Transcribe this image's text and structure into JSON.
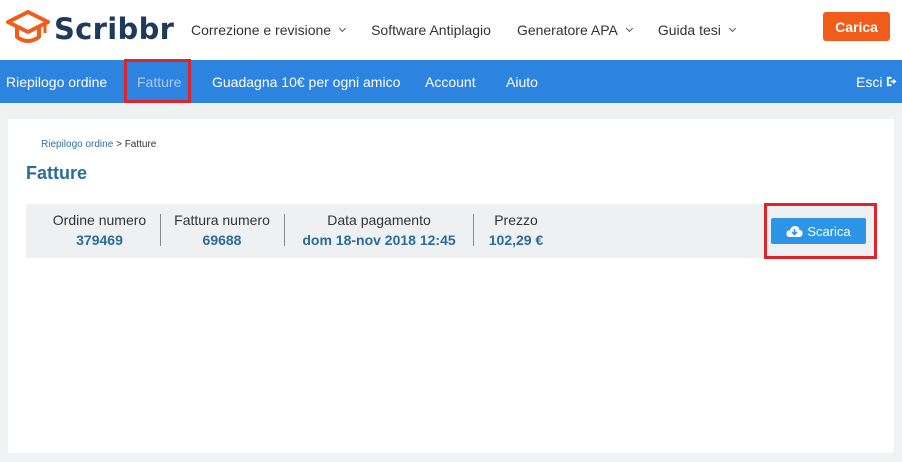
{
  "brand": {
    "name": "Scribbr",
    "color": "#1f3a5a",
    "accent": "#f25c1a"
  },
  "topnav": [
    {
      "label": "Correzione e revisione",
      "dropdown": true
    },
    {
      "label": "Software Antiplagio",
      "dropdown": false
    },
    {
      "label": "Generatore APA",
      "dropdown": true
    },
    {
      "label": "Guida tesi",
      "dropdown": true
    }
  ],
  "upload_label": "Carica",
  "subnav": {
    "items": [
      "Riepilogo ordine",
      "Fatture",
      "Guadagna 10€ per ogni amico",
      "Account",
      "Aiuto"
    ],
    "active": "Fatture",
    "logout_label": "Esci",
    "color": "#2d83e0"
  },
  "breadcrumb": {
    "parent": "Riepilogo ordine",
    "separator": ">",
    "current": "Fatture"
  },
  "page_title": "Fatture",
  "invoice": {
    "order_label": "Ordine numero",
    "order_value": "379469",
    "invoice_label": "Fattura numero",
    "invoice_value": "69688",
    "date_label": "Data pagamento",
    "date_value": "dom 18-nov 2018 12:45",
    "price_label": "Prezzo",
    "price_value": "102,29 €"
  },
  "download_label": "Scarica",
  "highlight_color": "#d9262d"
}
